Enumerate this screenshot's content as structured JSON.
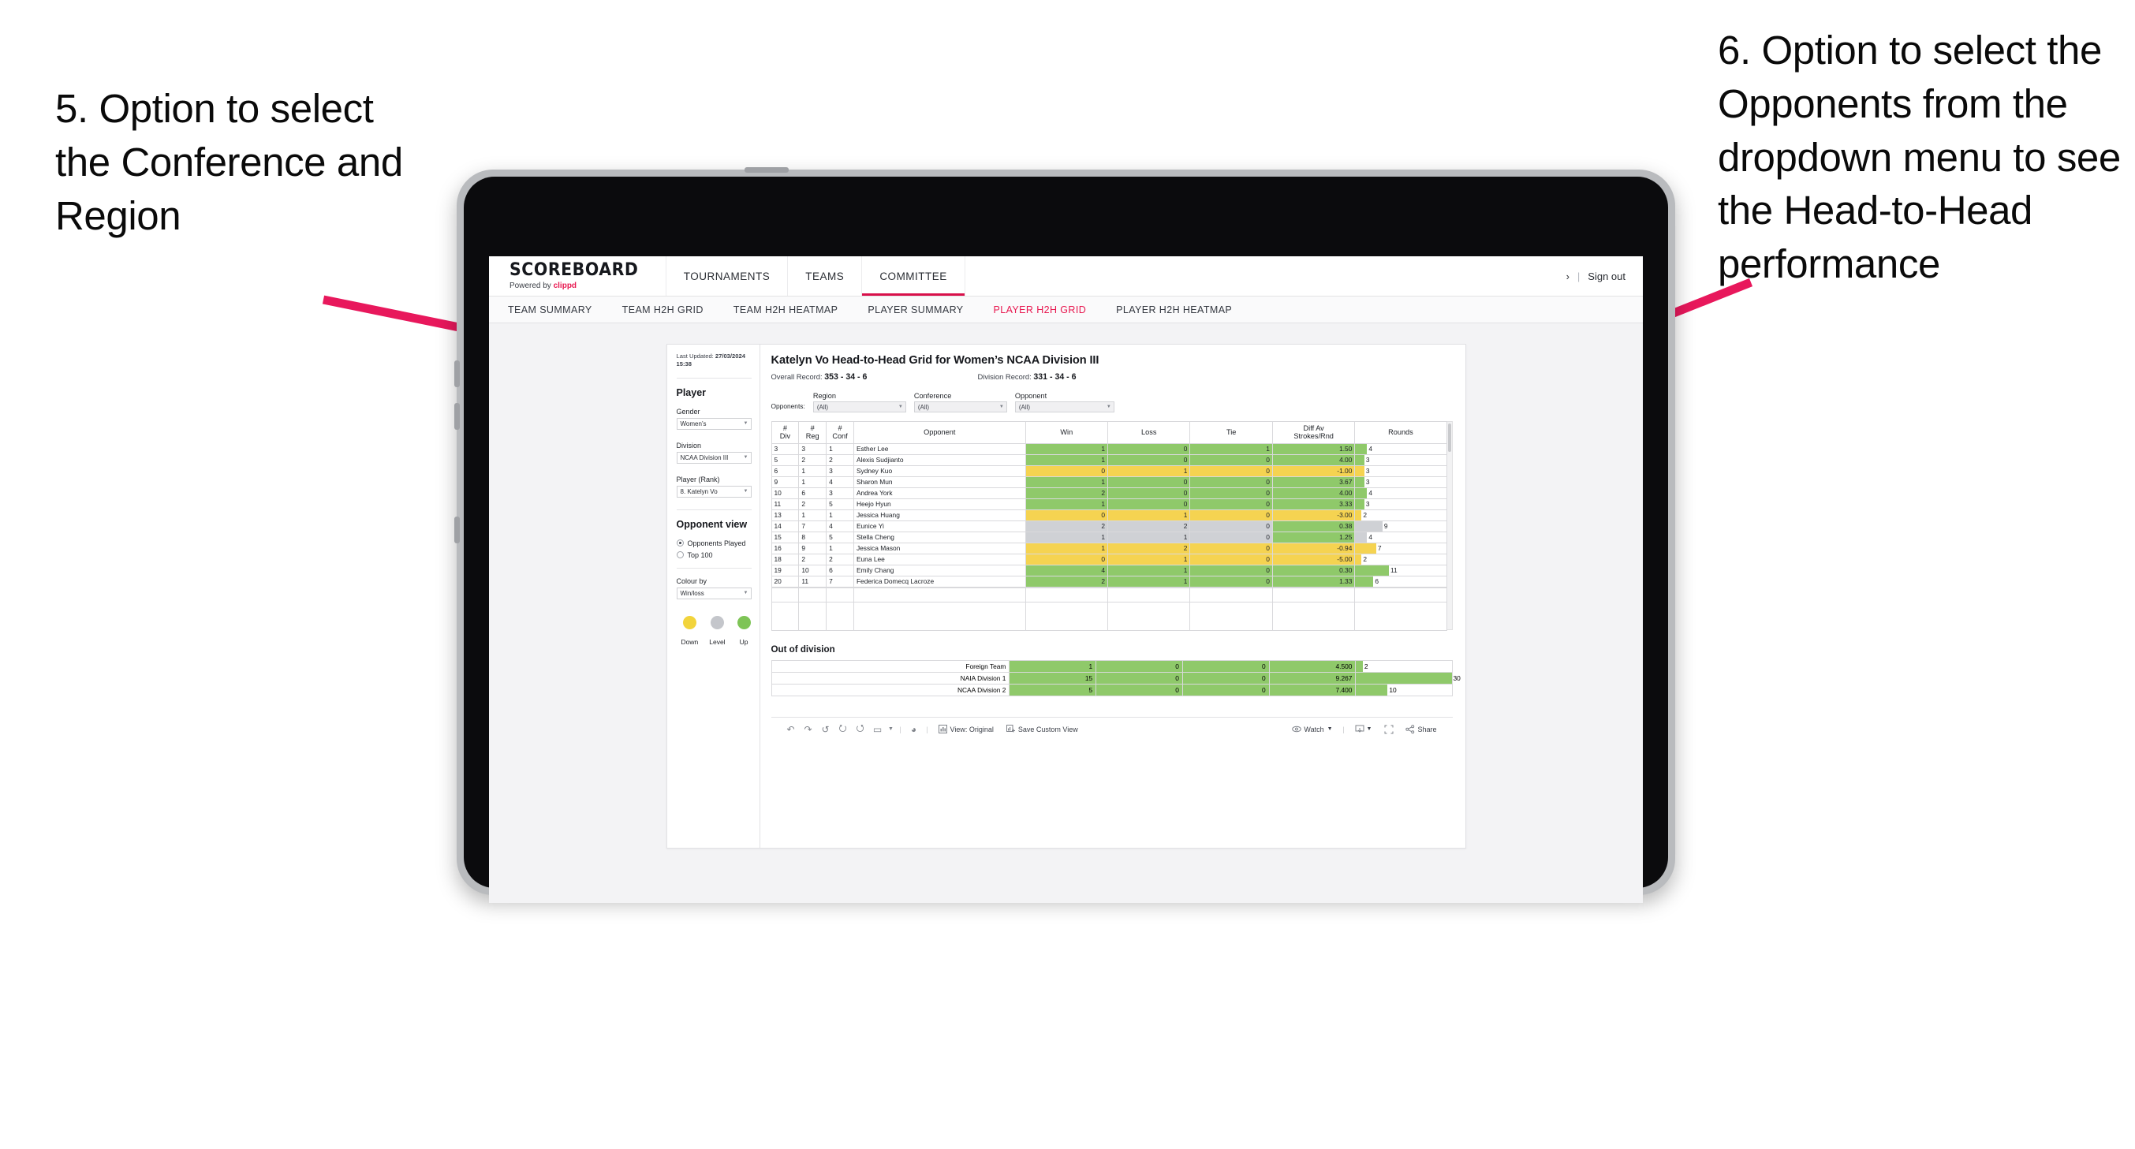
{
  "annotations": {
    "left": "5. Option to select the Conference and Region",
    "right": "6. Option to select the Opponents from the dropdown menu to see the Head-to-Head performance",
    "arrow_color": "#e8185c"
  },
  "app": {
    "brand": {
      "name": "SCOREBOARD",
      "powered_prefix": "Powered by ",
      "powered_brand": "clippd"
    },
    "nav_tabs": [
      {
        "label": "TOURNAMENTS",
        "active": false
      },
      {
        "label": "TEAMS",
        "active": false
      },
      {
        "label": "COMMITTEE",
        "active": true
      }
    ],
    "nav_right": {
      "chevron": "›",
      "separator": "|",
      "sign_out": "Sign out"
    },
    "sub_tabs": [
      {
        "label": "TEAM SUMMARY",
        "active": false
      },
      {
        "label": "TEAM H2H GRID",
        "active": false
      },
      {
        "label": "TEAM H2H HEATMAP",
        "active": false
      },
      {
        "label": "PLAYER SUMMARY",
        "active": false
      },
      {
        "label": "PLAYER H2H GRID",
        "active": true
      },
      {
        "label": "PLAYER H2H HEATMAP",
        "active": false
      }
    ],
    "accent_color": "#e8174f"
  },
  "sidebar": {
    "last_updated_label": "Last Updated: ",
    "last_updated_value": "27/03/2024",
    "last_updated_time": "15:38",
    "player_heading": "Player",
    "fields": [
      {
        "label": "Gender",
        "value": "Women’s"
      },
      {
        "label": "Division",
        "value": "NCAA Division III"
      },
      {
        "label": "Player (Rank)",
        "value": "8. Katelyn Vo"
      }
    ],
    "opponent_view": {
      "heading": "Opponent view",
      "options": [
        {
          "label": "Opponents Played",
          "selected": true
        },
        {
          "label": "Top 100",
          "selected": false
        }
      ]
    },
    "colour_by": {
      "label": "Colour by",
      "value": "Win/loss"
    },
    "legend": [
      {
        "label": "Down",
        "color": "#f2d43c"
      },
      {
        "label": "Level",
        "color": "#c4c6cb"
      },
      {
        "label": "Up",
        "color": "#7ec456"
      }
    ]
  },
  "main": {
    "title": "Katelyn Vo Head-to-Head Grid for Women’s NCAA Division III",
    "overall_record_label": "Overall Record: ",
    "overall_record_value": "353 -  34 - 6",
    "division_record_label": "Division Record: ",
    "division_record_value": "331 -  34 - 6",
    "opponents_label": "Opponents:",
    "filters": [
      {
        "label": "Region",
        "value": "(All)"
      },
      {
        "label": "Conference",
        "value": "(All)"
      },
      {
        "label": "Opponent",
        "value": "(All)"
      }
    ]
  },
  "chart_data": {
    "type": "table",
    "title": "Katelyn Vo Head-to-Head Grid for Women’s NCAA Division III",
    "columns": [
      "# Div",
      "# Reg",
      "# Conf",
      "Opponent",
      "Win",
      "Loss",
      "Tie",
      "Diff Av Strokes/Rnd",
      "Rounds"
    ],
    "column_headers_two_line": [
      {
        "l1": "#",
        "l2": "Div"
      },
      {
        "l1": "#",
        "l2": "Reg"
      },
      {
        "l1": "#",
        "l2": "Conf"
      },
      {
        "l1": "Opponent",
        "l2": ""
      },
      {
        "l1": "Win",
        "l2": ""
      },
      {
        "l1": "Loss",
        "l2": ""
      },
      {
        "l1": "Tie",
        "l2": ""
      },
      {
        "l1": "Diff Av",
        "l2": "Strokes/Rnd"
      },
      {
        "l1": "Rounds",
        "l2": ""
      }
    ],
    "rows": [
      {
        "div": "3",
        "reg": "3",
        "conf": "1",
        "opponent": "Esther Lee",
        "win": "1",
        "loss": "0",
        "tie": "1",
        "diff": "1.50",
        "rounds": 4,
        "color": "#8fc96a"
      },
      {
        "div": "5",
        "reg": "2",
        "conf": "2",
        "opponent": "Alexis Sudjianto",
        "win": "1",
        "loss": "0",
        "tie": "0",
        "diff": "4.00",
        "rounds": 3,
        "color": "#8fc96a"
      },
      {
        "div": "6",
        "reg": "1",
        "conf": "3",
        "opponent": "Sydney Kuo",
        "win": "0",
        "loss": "1",
        "tie": "0",
        "diff": "-1.00",
        "rounds": 3,
        "color": "#f5d351"
      },
      {
        "div": "9",
        "reg": "1",
        "conf": "4",
        "opponent": "Sharon Mun",
        "win": "1",
        "loss": "0",
        "tie": "0",
        "diff": "3.67",
        "rounds": 3,
        "color": "#8fc96a"
      },
      {
        "div": "10",
        "reg": "6",
        "conf": "3",
        "opponent": "Andrea York",
        "win": "2",
        "loss": "0",
        "tie": "0",
        "diff": "4.00",
        "rounds": 4,
        "color": "#8fc96a"
      },
      {
        "div": "11",
        "reg": "2",
        "conf": "5",
        "opponent": "Heejo Hyun",
        "win": "1",
        "loss": "0",
        "tie": "0",
        "diff": "3.33",
        "rounds": 3,
        "color": "#8fc96a"
      },
      {
        "div": "13",
        "reg": "1",
        "conf": "1",
        "opponent": "Jessica Huang",
        "win": "0",
        "loss": "1",
        "tie": "0",
        "diff": "-3.00",
        "rounds": 2,
        "color": "#f5d351"
      },
      {
        "div": "14",
        "reg": "7",
        "conf": "4",
        "opponent": "Eunice Yi",
        "win": "2",
        "loss": "2",
        "tie": "0",
        "diff": "0.38",
        "rounds": 9,
        "color": "#cfd1d5",
        "diff_color": "#8fc96a"
      },
      {
        "div": "15",
        "reg": "8",
        "conf": "5",
        "opponent": "Stella Cheng",
        "win": "1",
        "loss": "1",
        "tie": "0",
        "diff": "1.25",
        "rounds": 4,
        "color": "#cfd1d5",
        "diff_color": "#8fc96a"
      },
      {
        "div": "16",
        "reg": "9",
        "conf": "1",
        "opponent": "Jessica Mason",
        "win": "1",
        "loss": "2",
        "tie": "0",
        "diff": "-0.94",
        "rounds": 7,
        "color": "#f5d351"
      },
      {
        "div": "18",
        "reg": "2",
        "conf": "2",
        "opponent": "Euna Lee",
        "win": "0",
        "loss": "1",
        "tie": "0",
        "diff": "-5.00",
        "rounds": 2,
        "color": "#f5d351"
      },
      {
        "div": "19",
        "reg": "10",
        "conf": "6",
        "opponent": "Emily Chang",
        "win": "4",
        "loss": "1",
        "tie": "0",
        "diff": "0.30",
        "rounds": 11,
        "color": "#8fc96a"
      },
      {
        "div": "20",
        "reg": "11",
        "conf": "7",
        "opponent": "Federica Domecq Lacroze",
        "win": "2",
        "loss": "1",
        "tie": "0",
        "diff": "1.33",
        "rounds": 6,
        "color": "#8fc96a"
      }
    ],
    "rounds_max": 30,
    "out_of_division": {
      "title": "Out of division",
      "rows": [
        {
          "name": "Foreign Team",
          "win": "1",
          "loss": "0",
          "tie": "0",
          "diff": "4.500",
          "rounds": 2,
          "color": "#8fc96a"
        },
        {
          "name": "NAIA Division 1",
          "win": "15",
          "loss": "0",
          "tie": "0",
          "diff": "9.267",
          "rounds": 30,
          "color": "#8fc96a"
        },
        {
          "name": "NCAA Division 2",
          "win": "5",
          "loss": "0",
          "tie": "0",
          "diff": "7.400",
          "rounds": 10,
          "color": "#8fc96a"
        }
      ]
    }
  },
  "toolbar": {
    "icons": [
      "undo-icon",
      "redo-icon",
      "revert-icon",
      "refresh-icon",
      "pause-icon",
      "highlight-icon"
    ],
    "glyphs": [
      "↶",
      "↷",
      "↺",
      "⟳",
      "⏸",
      "▭"
    ],
    "view_label": "View: Original",
    "save_label": "Save Custom View",
    "watch_label": "Watch",
    "share_label": "Share"
  }
}
